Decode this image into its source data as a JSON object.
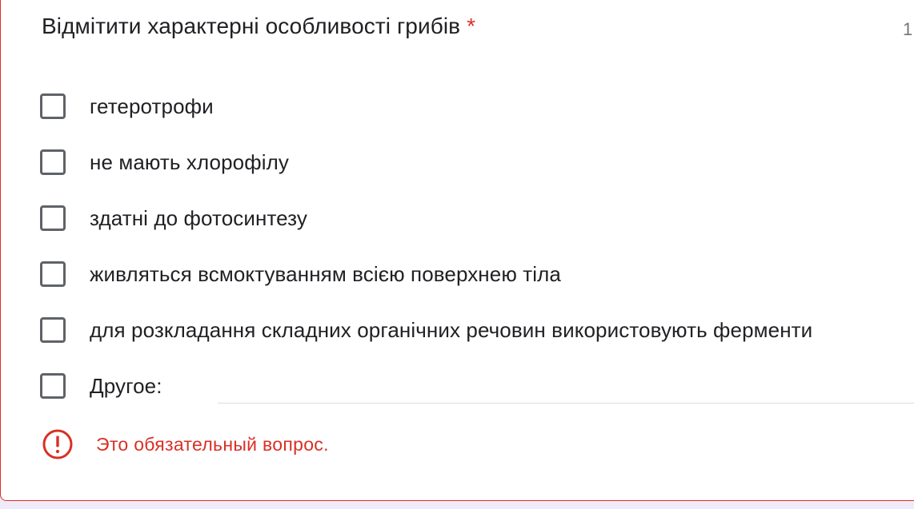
{
  "question": {
    "title": "Відмітити характерні особливості грибів",
    "required_marker": "*",
    "points": "1"
  },
  "options": [
    {
      "label": "гетеротрофи",
      "checked": false
    },
    {
      "label": "не мають хлорофілу",
      "checked": false
    },
    {
      "label": "здатні до фотосинтезу",
      "checked": false
    },
    {
      "label": "живляться всмоктуванням всією поверхнею тіла",
      "checked": false
    },
    {
      "label": "для розкладання складних органічних речовин використовують ферменти",
      "checked": false
    },
    {
      "label": "Другое:",
      "checked": false
    }
  ],
  "other_input": {
    "value": "",
    "placeholder": ""
  },
  "error": {
    "icon": "error-icon",
    "message": "Это обязательный вопрос."
  },
  "colors": {
    "error": "#d93025",
    "text": "#202124",
    "checkbox_border": "#5f6368",
    "background": "#f0ebf8"
  }
}
